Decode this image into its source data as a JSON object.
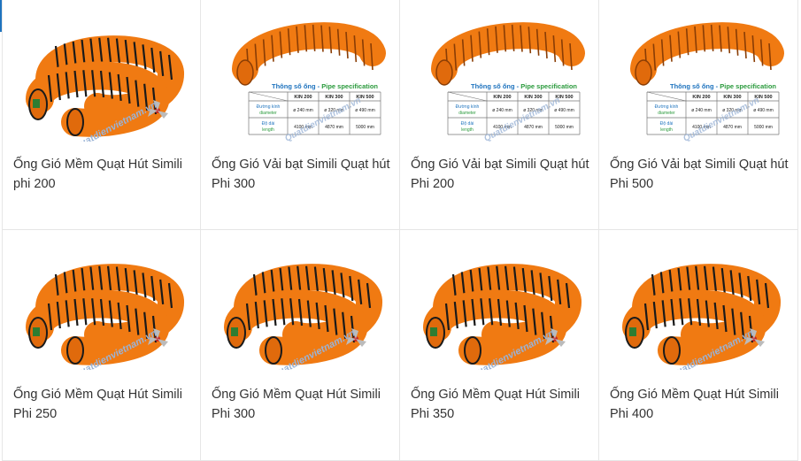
{
  "products": [
    {
      "name": "Ống Gió Mềm Quạt Hút Simili phi 200",
      "image": "flexible-duct-coil"
    },
    {
      "name": "Ống Gió Vải bạt Simili Quạt hút Phi 300",
      "image": "duct-with-spec-table"
    },
    {
      "name": "Ống Gió Vải bạt Simili Quạt hút Phi 200",
      "image": "duct-with-spec-table"
    },
    {
      "name": "Ống Gió Vải bạt Simili Quạt hút Phi 500",
      "image": "duct-with-spec-table"
    },
    {
      "name": "Ống Gió Mềm Quạt Hút Simili Phi 250",
      "image": "flexible-duct-coil"
    },
    {
      "name": "Ống Gió Mềm Quạt Hút Simili Phi 300",
      "image": "flexible-duct-coil"
    },
    {
      "name": "Ống Gió Mềm Quạt Hút Simili Phi 350",
      "image": "flexible-duct-coil"
    },
    {
      "name": "Ống Gió Mềm Quạt Hút Simili Phi 400",
      "image": "flexible-duct-coil"
    }
  ],
  "spec_table": {
    "title_vi": "Thông số ống",
    "title_sep": " - ",
    "title_en": "Pipe specification",
    "headers": [
      "KIN 200",
      "KIN 300",
      "KIN 500"
    ],
    "rows": [
      {
        "label_vi": "Đường kính",
        "label_en": "diameter",
        "values": [
          "ø 240 mm",
          "ø 320 mm",
          "ø 490 mm"
        ]
      },
      {
        "label_vi": "Độ dài",
        "label_en": "length",
        "values": [
          "4100 mm",
          "4870 mm",
          "5000 mm"
        ]
      }
    ]
  },
  "watermark": "Quatdienvietnam.vn",
  "colors": {
    "duct_orange": "#f07a12",
    "duct_black": "#1a1a1a",
    "spec_green": "#2a9a3c",
    "spec_blue": "#1e73be",
    "text": "#333333",
    "accent": "#1e73be"
  }
}
